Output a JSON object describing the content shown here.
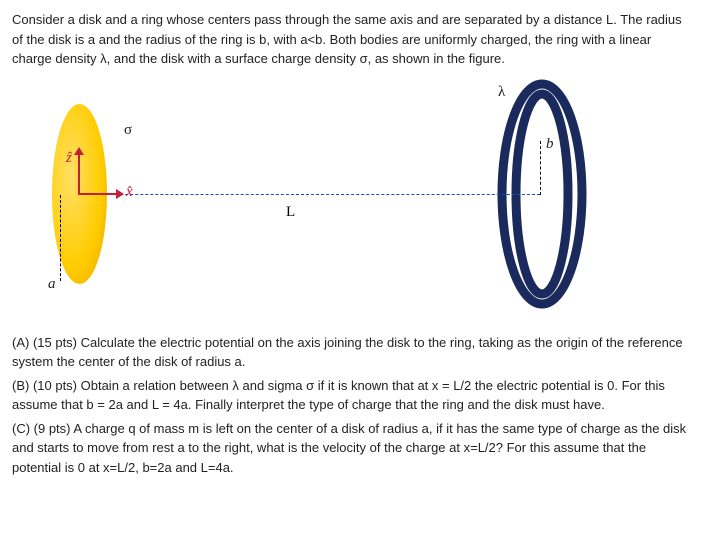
{
  "problem": {
    "intro": "Consider a disk and a ring whose centers pass through the same axis and are separated by a distance L. The radius of the disk is a and the radius of the ring is b, with a<b. Both bodies are uniformly charged, the ring with a linear charge density λ, and the disk with a surface charge density σ, as shown in the figure."
  },
  "figure": {
    "sigma": "σ",
    "lambda": "λ",
    "z_hat": "ẑ",
    "x_hat": "x̂",
    "L": "L",
    "a": "a",
    "b": "b"
  },
  "questions": {
    "A": "(A) (15 pts) Calculate the electric potential on the axis joining the disk to the ring, taking as the origin of the reference system the center of the disk of radius a.",
    "B": "(B) (10 pts) Obtain a relation between λ and sigma σ if it is known that at x = L/2 the electric potential is 0. For this assume that b = 2a and L = 4a. Finally interpret the type of charge that the ring and the disk must have.",
    "C": "(C) (9 pts) A charge q of mass m is left on the center of a disk of radius a, if it has the same type of charge as the disk and starts to move from rest a to the right, what is the velocity of the charge at x=L/2? For this assume that the potential is 0 at x=L/2, b=2a and L=4a."
  }
}
